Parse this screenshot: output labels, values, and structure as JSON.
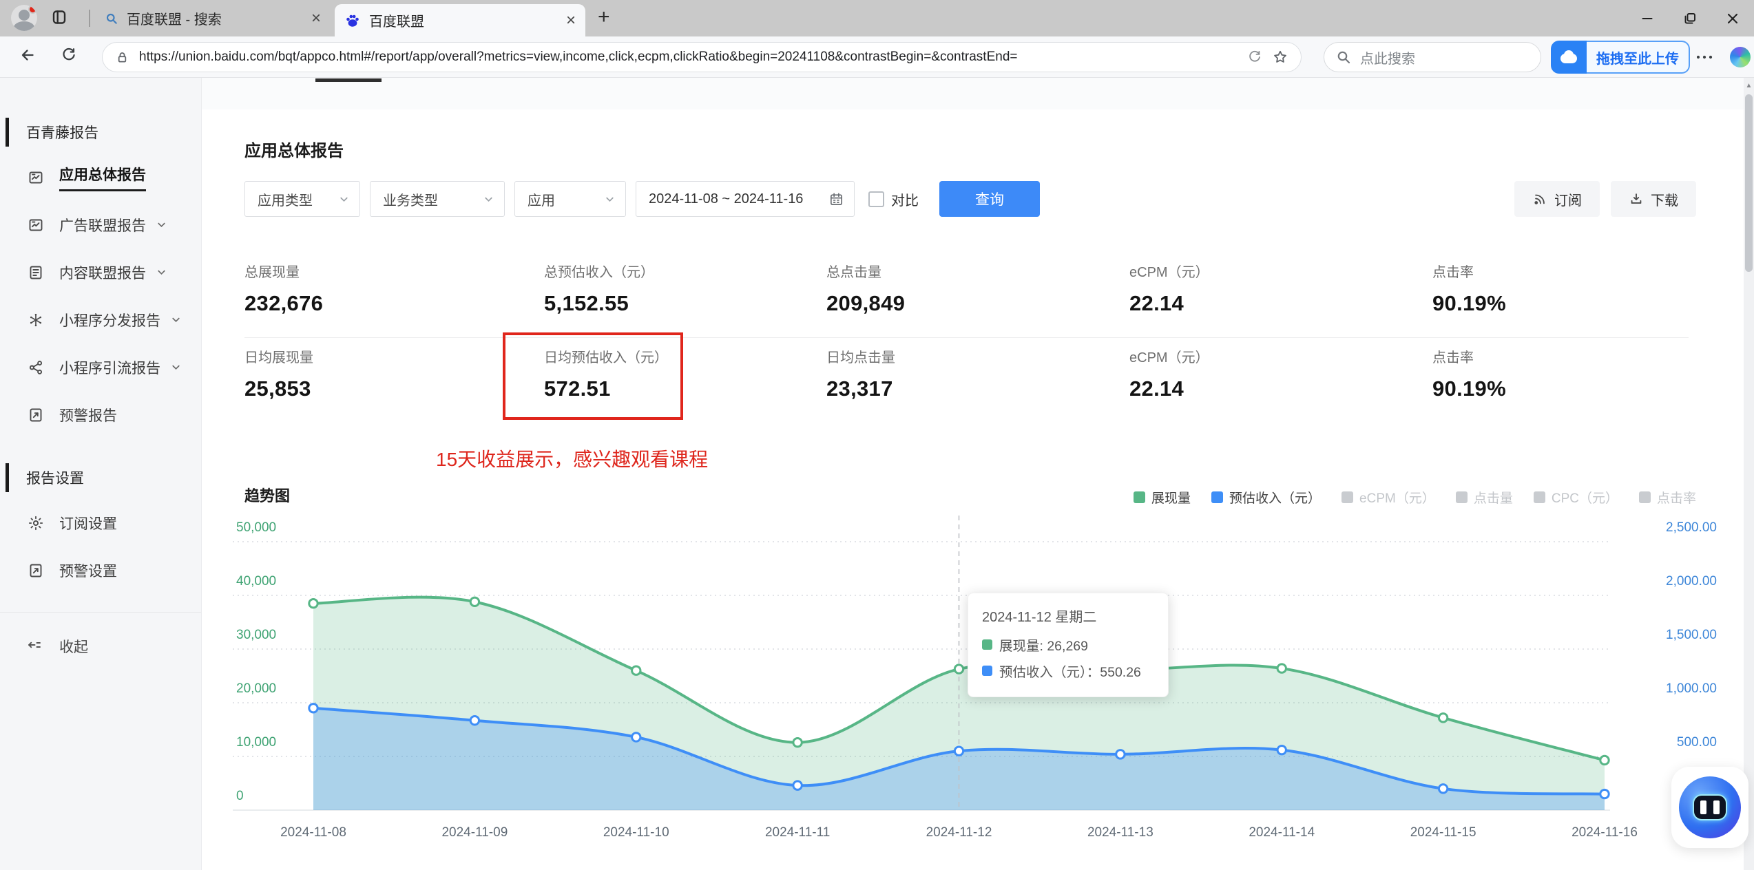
{
  "browser": {
    "tab1": "百度联盟 - 搜索",
    "tab2": "百度联盟",
    "url": "https://union.baidu.com/bqt/appco.html#/report/app/overall?metrics=view,income,click,ecpm,clickRatio&begin=20241108&contrastBegin=&contrastEnd=",
    "search_placeholder": "点此搜索",
    "upload_label": "拖拽至此上传"
  },
  "sidebar": {
    "section1": "百青藤报告",
    "items1": [
      {
        "label": "应用总体报告",
        "icon": "report",
        "active": true
      },
      {
        "label": "广告联盟报告",
        "icon": "report",
        "chevron": true
      },
      {
        "label": "内容联盟报告",
        "icon": "content",
        "chevron": true
      },
      {
        "label": "小程序分发报告",
        "icon": "distribute",
        "chevron": true
      },
      {
        "label": "小程序引流报告",
        "icon": "share",
        "chevron": true
      },
      {
        "label": "预警报告",
        "icon": "alert"
      }
    ],
    "section2": "报告设置",
    "items2": [
      {
        "label": "订阅设置",
        "icon": "gear"
      },
      {
        "label": "预警设置",
        "icon": "alert"
      }
    ],
    "collapse": "收起"
  },
  "page": {
    "title": "应用总体报告",
    "filters": {
      "app_type": "应用类型",
      "biz_type": "业务类型",
      "app": "应用",
      "date_range": "2024-11-08 ~ 2024-11-16",
      "contrast": "对比",
      "query": "查询"
    },
    "actions": {
      "subscribe": "订阅",
      "download": "下载"
    },
    "stats": [
      {
        "label": "总展现量",
        "value": "232,676"
      },
      {
        "label": "总预估收入（元）",
        "value": "5,152.55"
      },
      {
        "label": "总点击量",
        "value": "209,849"
      },
      {
        "label": "eCPM（元）",
        "value": "22.14"
      },
      {
        "label": "点击率",
        "value": "90.19%"
      },
      {
        "label": "日均展现量",
        "value": "25,853"
      },
      {
        "label": "日均预估收入（元）",
        "value": "572.51"
      },
      {
        "label": "日均点击量",
        "value": "23,317"
      },
      {
        "label": "eCPM（元）",
        "value": "22.14"
      },
      {
        "label": "点击率",
        "value": "90.19%"
      }
    ],
    "annotation": "15天收益展示，感兴趣观看课程"
  },
  "chart_data": {
    "type": "area",
    "title": "趋势图",
    "x": [
      "2024-11-08",
      "2024-11-09",
      "2024-11-10",
      "2024-11-11",
      "2024-11-12",
      "2024-11-13",
      "2024-11-14",
      "2024-11-15",
      "2024-11-16"
    ],
    "series": [
      {
        "name": "展现量",
        "color": "#57b686",
        "fill": "rgba(87,182,134,0.22)",
        "axis": "left",
        "values": [
          38500,
          38800,
          26000,
          12600,
          26269,
          26100,
          26400,
          17200,
          9300
        ]
      },
      {
        "name": "预估收入（元）",
        "color": "#3e8ef7",
        "fill": "rgba(62,142,247,0.30)",
        "axis": "right",
        "values": [
          950,
          835,
          680,
          230,
          550.26,
          520,
          560,
          200,
          150
        ]
      }
    ],
    "left_axis": {
      "max": 50000,
      "color": "#3fa373",
      "ticks": [
        "50,000",
        "40,000",
        "30,000",
        "20,000",
        "10,000",
        "0"
      ]
    },
    "right_axis": {
      "max": 2500,
      "color": "#3d86d8",
      "ticks": [
        "2,500.00",
        "2,000.00",
        "1,500.00",
        "1,000.00",
        "500.00",
        "0"
      ]
    },
    "legend": [
      {
        "label": "展现量",
        "color": "#57b686",
        "active": true
      },
      {
        "label": "预估收入（元）",
        "color": "#3e8ef7",
        "active": true
      },
      {
        "label": "eCPM（元）",
        "color": "#c9ccd0",
        "active": false
      },
      {
        "label": "点击量",
        "color": "#c9ccd0",
        "active": false
      },
      {
        "label": "CPC（元）",
        "color": "#c9ccd0",
        "active": false
      },
      {
        "label": "点击率",
        "color": "#c9ccd0",
        "active": false
      }
    ],
    "grid": true,
    "legend_position": "top-right",
    "hover_index": 4,
    "tooltip": {
      "title": "2024-11-12 星期二",
      "rows": [
        {
          "color": "#57b686",
          "text": "展现量: 26,269"
        },
        {
          "color": "#3e8ef7",
          "text": "预估收入（元）：550.26"
        }
      ]
    }
  }
}
